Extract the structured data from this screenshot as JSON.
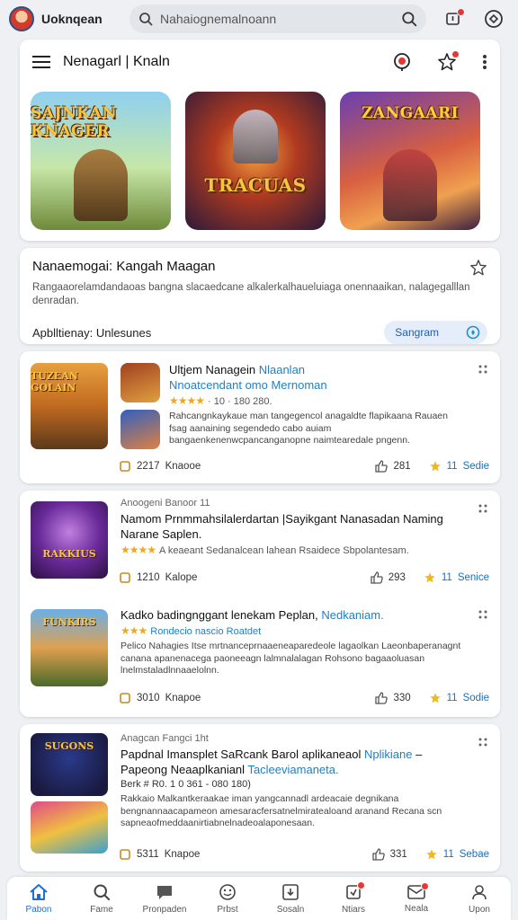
{
  "topbar": {
    "app_title": "Uoknqean",
    "search_placeholder": "Nahaiognemalnoann"
  },
  "header": {
    "title": "Nenagarl | Knaln"
  },
  "heroes": [
    {
      "label": "SAJNKAN KNAGER"
    },
    {
      "label": "TRACUAS"
    },
    {
      "label": "ZANGAARI"
    }
  ],
  "info": {
    "title": "Nanaemogai: Kangah Maagan",
    "description": "Rangaaorelamdandaoas bangna slacaedcane alkalerkalhaueluiaga onennaaikan, nalagegalllan denradan.",
    "meta": "Apblltienay: Unlesunes",
    "button_label": "Sangram"
  },
  "items": [
    {
      "title_a": "Ultjem Nanagein ",
      "title_b": "Nlaanlan",
      "title_c": "Nnoatcendant omo ",
      "title_d": "Mernoman",
      "stars": "★★★★",
      "rating_text": "· 10 · 180 280.",
      "description": "Rahcangnkaykaue man tangegencol anagaldte flapikaana Rauaen fsag aanaining segendedo cabo auiam bangaenkenenwcpancanganopne naimtearedale pngenn.",
      "thumb_main": "TUZEAN GOLAIN",
      "footer_count": "2217",
      "footer_label": "Knaooe",
      "like_count": "281",
      "star_count": "11",
      "footer_action": "Sedie"
    },
    {
      "eyebrow": "Anoogeni Banoor 11",
      "title_a": "Namom Prnmmahsilalerdartan |Sayikgant Nanasadan Naming Narane Saplen.",
      "stars": "★★★★",
      "rating_text": "A keaeant Sedanalcean lahean Rsaidece Sbpolantesam.",
      "thumb_main": "RAKKIUS",
      "footer_count": "1210",
      "footer_label": "Kalope",
      "like_count": "293",
      "star_count": "11",
      "footer_action": "Senice"
    },
    {
      "title_a": "Kadko badingnggant lenekam Peplan, ",
      "title_b": "Nedkaniam.",
      "stars": "★★★",
      "rating_text": "Rondecio nascio Roatdet",
      "description": "Pelico Nahagies Itse mrtnanceprnaaeneaparedeole lagaolkan Laeonbaperanagnt canana apanenacega paoneeagn lalmnalalagan Rohsono bagaaoluasan lnelmstaladlnnaaelolnn.",
      "thumb_main": "FUNKIRS",
      "footer_count": "3010",
      "footer_label": "Knapoe",
      "like_count": "330",
      "star_count": "11",
      "footer_action": "Sodie"
    },
    {
      "eyebrow": "Anagcan Fangci 1ht",
      "title_a": "Papdnal Imansplet SaRcank Barol aplikaneaol ",
      "title_b": "Nplikiane",
      "title_c": " – Papeong Neaaplkanianl ",
      "title_d": "Tacleeviamaneta.",
      "rating_text": "Berk # R0. 1 0 361 - 080 180)",
      "description": "Rakkaio Malkantkeraakae iman yangcannadl ardeacaie degnikana bengnannaacapameon amesaracfersatnelmiratealoand aranand Recana scn sapneaofmeddaanirtiabnelnadeoalaponesaan.",
      "thumb_main": "SUGONS",
      "footer_count": "5311",
      "footer_label": "Knapoe",
      "like_count": "331",
      "star_count": "11",
      "footer_action": "Sebae"
    }
  ],
  "bottom_nav": [
    {
      "label": "Pabon",
      "icon": "home-icon"
    },
    {
      "label": "Fame",
      "icon": "search-icon"
    },
    {
      "label": "Pronpaden",
      "icon": "chat-icon"
    },
    {
      "label": "Prbst",
      "icon": "smile-icon"
    },
    {
      "label": "Sosaln",
      "icon": "download-icon"
    },
    {
      "label": "Ntiars",
      "icon": "apps-icon"
    },
    {
      "label": "Neala",
      "icon": "mail-icon"
    },
    {
      "label": "Upon",
      "icon": "user-icon"
    }
  ],
  "colors": {
    "accent": "#1f6fd0",
    "link": "#1f7fc4",
    "star": "#f0a81a",
    "badge": "#e53935"
  }
}
